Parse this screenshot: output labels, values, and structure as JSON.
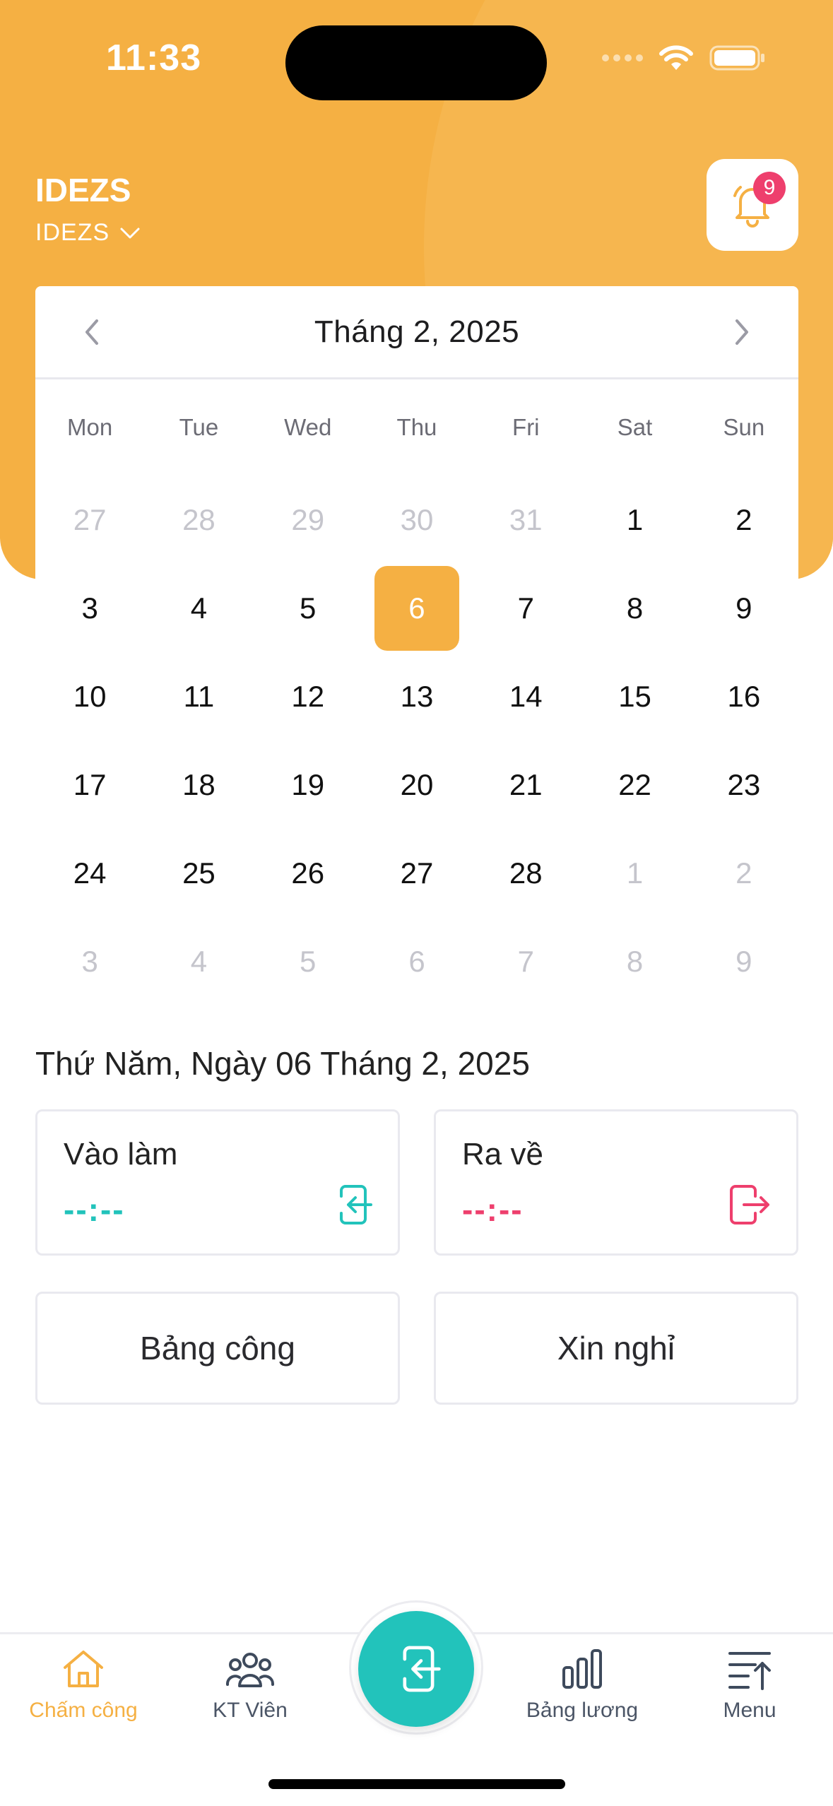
{
  "status_bar": {
    "time": "11:33"
  },
  "header": {
    "title": "IDEZS",
    "subtitle": "IDEZS",
    "notification_count": "9"
  },
  "calendar": {
    "month_label": "Tháng 2, 2025",
    "weekdays": [
      "Mon",
      "Tue",
      "Wed",
      "Thu",
      "Fri",
      "Sat",
      "Sun"
    ],
    "weeks": [
      [
        {
          "d": "27",
          "m": true
        },
        {
          "d": "28",
          "m": true
        },
        {
          "d": "29",
          "m": true
        },
        {
          "d": "30",
          "m": true
        },
        {
          "d": "31",
          "m": true
        },
        {
          "d": "1",
          "m": false
        },
        {
          "d": "2",
          "m": false
        }
      ],
      [
        {
          "d": "3",
          "m": false
        },
        {
          "d": "4",
          "m": false
        },
        {
          "d": "5",
          "m": false
        },
        {
          "d": "6",
          "m": false,
          "selected": true
        },
        {
          "d": "7",
          "m": false
        },
        {
          "d": "8",
          "m": false
        },
        {
          "d": "9",
          "m": false
        }
      ],
      [
        {
          "d": "10",
          "m": false
        },
        {
          "d": "11",
          "m": false
        },
        {
          "d": "12",
          "m": false
        },
        {
          "d": "13",
          "m": false
        },
        {
          "d": "14",
          "m": false
        },
        {
          "d": "15",
          "m": false
        },
        {
          "d": "16",
          "m": false
        }
      ],
      [
        {
          "d": "17",
          "m": false
        },
        {
          "d": "18",
          "m": false
        },
        {
          "d": "19",
          "m": false
        },
        {
          "d": "20",
          "m": false
        },
        {
          "d": "21",
          "m": false
        },
        {
          "d": "22",
          "m": false
        },
        {
          "d": "23",
          "m": false
        }
      ],
      [
        {
          "d": "24",
          "m": false
        },
        {
          "d": "25",
          "m": false
        },
        {
          "d": "26",
          "m": false
        },
        {
          "d": "27",
          "m": false
        },
        {
          "d": "28",
          "m": false
        },
        {
          "d": "1",
          "m": true
        },
        {
          "d": "2",
          "m": true
        }
      ],
      [
        {
          "d": "3",
          "m": true
        },
        {
          "d": "4",
          "m": true
        },
        {
          "d": "5",
          "m": true
        },
        {
          "d": "6",
          "m": true
        },
        {
          "d": "7",
          "m": true
        },
        {
          "d": "8",
          "m": true
        },
        {
          "d": "9",
          "m": true
        }
      ]
    ]
  },
  "selected_date_label": "Thứ Năm, Ngày 06 Tháng 2, 2025",
  "check_in": {
    "label": "Vào làm",
    "time": "--:--"
  },
  "check_out": {
    "label": "Ra về",
    "time": "--:--"
  },
  "actions": {
    "timesheet": "Bảng công",
    "leave": "Xin nghỉ"
  },
  "tabs": {
    "attendance": "Chấm công",
    "staff": "KT Viên",
    "payroll": "Bảng lương",
    "menu": "Menu"
  },
  "colors": {
    "accent": "#f5b043",
    "teal": "#22c3bb",
    "pink": "#ee3f6d"
  }
}
